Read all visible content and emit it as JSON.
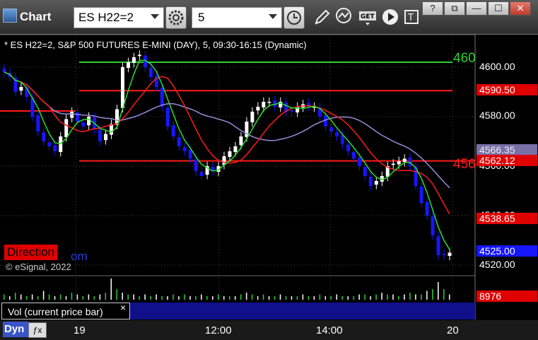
{
  "titlebar": {
    "app_title": "Chart",
    "symbol": "ES H22=2",
    "interval": "5",
    "win_help": "?",
    "win_restore": "⧉",
    "win_min": "—",
    "win_max": "☐",
    "win_close": "✕"
  },
  "chart": {
    "header": "* ES H22=2, S&P 500 FUTURES E-MINI (DAY), 5, 09:30-16:15 (Dynamic)",
    "price_labels": [
      "4600.00",
      "4580.00",
      "4560.00",
      "4540.00",
      "4520.00"
    ],
    "tags": {
      "red_top": "4590.50",
      "purple": "4566.35",
      "red_mid": "4562.12",
      "red_low": "4538.65",
      "blue_last": "4525.00"
    },
    "edge_green": "460",
    "edge_red": "456",
    "direction_label": "Direction",
    "com_text": "om",
    "copyright": "© eSignal, 2022",
    "colors": {
      "bull": "#ffffff",
      "bear": "#1616ff",
      "level_red": "#ff1a1a",
      "level_green": "#2ad12a",
      "ma_red": "#ff1a1a",
      "ma_purple": "#9a8ad8",
      "ma_green": "#26e026"
    }
  },
  "volume": {
    "label": "Vol (current price bar)",
    "close": "×",
    "value": "8976"
  },
  "time_axis": {
    "dyn": "Dyn",
    "fx": "ƒx",
    "labels": [
      "19",
      "12:00",
      "14:00",
      "20"
    ]
  },
  "chart_data": {
    "type": "line",
    "xlabel": "",
    "ylabel": "",
    "ylim": [
      4516,
      4610
    ],
    "x_ticks": [
      "19",
      "12:00",
      "14:00",
      "20"
    ],
    "y_ticks": [
      4600,
      4580,
      4560,
      4540,
      4520
    ],
    "levels": [
      4602,
      4590.5,
      4562.12
    ],
    "last_price": 4525.0,
    "series": [
      {
        "values": [
          4598,
          4596,
          4590,
          4592,
          4588,
          4580,
          4574,
          4570,
          4568,
          4566,
          4572,
          4579,
          4582,
          4578,
          4576,
          4580,
          4575,
          4570,
          4573,
          4577,
          4583,
          4600,
          4602,
          4604,
          4605,
          4600,
          4596,
          4592,
          4584,
          4576,
          4572,
          4568,
          4566,
          4563,
          4558,
          4556,
          4560,
          4558,
          4560,
          4564,
          4566,
          4568,
          4572,
          4578,
          4582,
          4584,
          4586,
          4586,
          4584,
          4586,
          4582,
          4582,
          4584,
          4585,
          4584,
          4584,
          4580,
          4576,
          4574,
          4572,
          4569,
          4566,
          4563,
          4560,
          4556,
          4552,
          4554,
          4556,
          4560,
          4561,
          4562,
          4563,
          4560,
          4552,
          4545,
          4540,
          4532,
          4524,
          4524,
          4525
        ]
      }
    ],
    "volume": [
      3,
      2,
      4,
      3,
      2,
      3,
      2,
      5,
      3,
      2,
      3,
      2,
      4,
      3,
      2,
      3,
      2,
      3,
      4,
      12,
      6,
      4,
      3,
      3,
      2,
      3,
      2,
      3,
      2,
      2,
      3,
      2,
      3,
      2,
      2,
      3,
      2,
      2,
      3,
      2,
      2,
      2,
      3,
      4,
      3,
      2,
      3,
      2,
      2,
      3,
      2,
      2,
      2,
      3,
      2,
      2,
      3,
      2,
      2,
      3,
      2,
      2,
      2,
      3,
      3,
      2,
      3,
      4,
      3,
      3,
      2,
      3,
      4,
      3,
      3,
      5,
      6,
      10,
      6,
      3
    ]
  }
}
